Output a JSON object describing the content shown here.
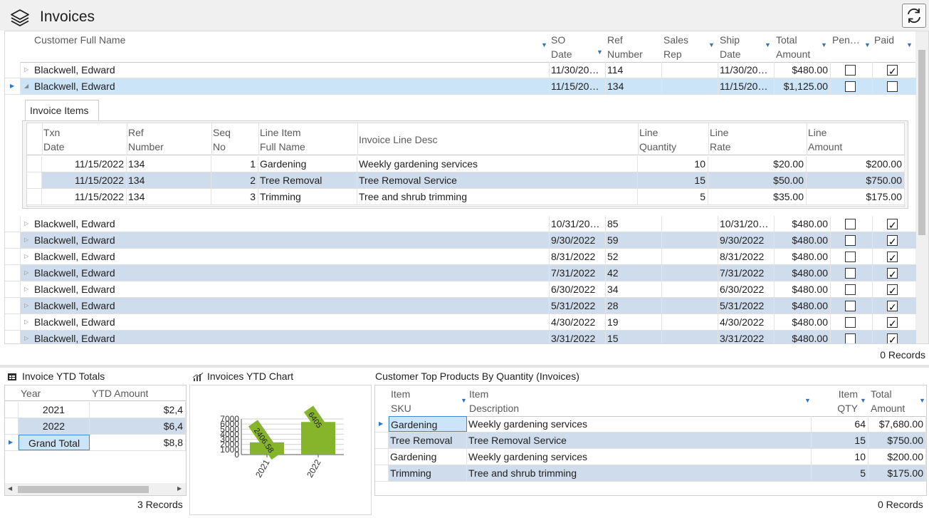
{
  "app": {
    "title": "Invoices"
  },
  "icons": {
    "app": "layers-icon",
    "refresh": "refresh-icon",
    "filter": "filter-icon",
    "totals": "table-icon",
    "chart": "chart-icon"
  },
  "colors": {
    "alt_row": "#cfdcec",
    "selected_row": "#cce4f7",
    "bar_fill": "#86b52b"
  },
  "invoices": {
    "columns": [
      "Customer Full Name",
      "SO Date",
      "Ref Number",
      "Sales Rep",
      "Ship Date",
      "Total Amount",
      "Pen…",
      "Paid"
    ],
    "header_lines": {
      "so_date": [
        "SO",
        "Date"
      ],
      "ref": [
        "Ref",
        "Number"
      ],
      "sales": [
        "Sales",
        "Rep"
      ],
      "ship": [
        "Ship",
        "Date"
      ],
      "total": [
        "Total",
        "Amount"
      ]
    },
    "rows": [
      {
        "customer": "Blackwell, Edward",
        "so_date": "11/30/20…",
        "ref": "114",
        "sales_rep": "",
        "ship_date": "11/30/20…",
        "total": "$480.00",
        "pending": false,
        "paid": true
      },
      {
        "customer": "Blackwell, Edward",
        "so_date": "11/15/20…",
        "ref": "134",
        "sales_rep": "",
        "ship_date": "11/15/20…",
        "total": "$1,125.00",
        "pending": false,
        "paid": false
      },
      {
        "customer": "Blackwell, Edward",
        "so_date": "10/31/20…",
        "ref": "85",
        "sales_rep": "",
        "ship_date": "10/31/20…",
        "total": "$480.00",
        "pending": false,
        "paid": true
      },
      {
        "customer": "Blackwell, Edward",
        "so_date": "9/30/2022",
        "ref": "59",
        "sales_rep": "",
        "ship_date": "9/30/2022",
        "total": "$480.00",
        "pending": false,
        "paid": true
      },
      {
        "customer": "Blackwell, Edward",
        "so_date": "8/31/2022",
        "ref": "52",
        "sales_rep": "",
        "ship_date": "8/31/2022",
        "total": "$480.00",
        "pending": false,
        "paid": true
      },
      {
        "customer": "Blackwell, Edward",
        "so_date": "7/31/2022",
        "ref": "42",
        "sales_rep": "",
        "ship_date": "7/31/2022",
        "total": "$480.00",
        "pending": false,
        "paid": true
      },
      {
        "customer": "Blackwell, Edward",
        "so_date": "6/30/2022",
        "ref": "34",
        "sales_rep": "",
        "ship_date": "6/30/2022",
        "total": "$480.00",
        "pending": false,
        "paid": true
      },
      {
        "customer": "Blackwell, Edward",
        "so_date": "5/31/2022",
        "ref": "28",
        "sales_rep": "",
        "ship_date": "5/31/2022",
        "total": "$480.00",
        "pending": false,
        "paid": true
      },
      {
        "customer": "Blackwell, Edward",
        "so_date": "4/30/2022",
        "ref": "19",
        "sales_rep": "",
        "ship_date": "4/30/2022",
        "total": "$480.00",
        "pending": false,
        "paid": true
      },
      {
        "customer": "Blackwell, Edward",
        "so_date": "3/31/2022",
        "ref": "15",
        "sales_rep": "",
        "ship_date": "3/31/2022",
        "total": "$480.00",
        "pending": false,
        "paid": true
      }
    ],
    "records_label": "0 Records"
  },
  "detail": {
    "tab_label": "Invoice Items",
    "header_lines": {
      "txn": [
        "Txn",
        "Date"
      ],
      "ref": [
        "Ref",
        "Number"
      ],
      "seq": [
        "Seq",
        "No"
      ],
      "item": [
        "Line Item",
        "Full Name"
      ],
      "desc": [
        "Invoice Line Desc"
      ],
      "qty": [
        "Line",
        "Quantity"
      ],
      "rate": [
        "Line",
        "Rate"
      ],
      "amount": [
        "Line",
        "Amount"
      ]
    },
    "rows": [
      {
        "txn_date": "11/15/2022",
        "ref": "134",
        "seq": "1",
        "item": "Gardening",
        "desc": "Weekly gardening services",
        "qty": "10",
        "rate": "$20.00",
        "amount": "$200.00"
      },
      {
        "txn_date": "11/15/2022",
        "ref": "134",
        "seq": "2",
        "item": "Tree Removal",
        "desc": "Tree Removal Service",
        "qty": "15",
        "rate": "$50.00",
        "amount": "$750.00"
      },
      {
        "txn_date": "11/15/2022",
        "ref": "134",
        "seq": "3",
        "item": "Trimming",
        "desc": "Tree and shrub trimming",
        "qty": "5",
        "rate": "$35.00",
        "amount": "$175.00"
      }
    ]
  },
  "ytd_totals": {
    "title": "Invoice YTD Totals",
    "col_year": "Year",
    "col_amount": "YTD Amount",
    "rows": [
      {
        "year": "2021",
        "amount": "$2,4"
      },
      {
        "year": "2022",
        "amount": "$6,4"
      },
      {
        "year": "Grand Total",
        "amount": "$8,8"
      }
    ],
    "records_label": "3 Records"
  },
  "chart": {
    "title": "Invoices YTD Chart"
  },
  "chart_data": {
    "type": "bar",
    "categories": [
      "2021",
      "2022"
    ],
    "values": [
      2406.58,
      6405
    ],
    "data_labels": [
      "2406.58",
      "6405"
    ],
    "ylim": [
      0,
      7000
    ],
    "yticks": [
      "7000",
      "6000",
      "5000",
      "4000",
      "3000",
      "2000",
      "1000",
      "0"
    ],
    "ytick_values": [
      7000,
      6000,
      5000,
      4000,
      3000,
      2000,
      1000,
      0
    ],
    "grid": true,
    "title": "",
    "xlabel": "",
    "ylabel": ""
  },
  "top_products": {
    "title": "Customer Top Products By Quantity (Invoices)",
    "header_lines": {
      "sku": [
        "Item",
        "SKU"
      ],
      "desc": [
        "Item",
        "Description"
      ],
      "qty": [
        "Item",
        "QTY"
      ],
      "amount": [
        "Total",
        "Amount"
      ]
    },
    "rows": [
      {
        "sku": "Gardening",
        "desc": "Weekly gardening services",
        "qty": "64",
        "amount": "$7,680.00"
      },
      {
        "sku": "Tree Removal",
        "desc": "Tree Removal Service",
        "qty": "15",
        "amount": "$750.00"
      },
      {
        "sku": "Gardening",
        "desc": "Weekly gardening services",
        "qty": "10",
        "amount": "$200.00"
      },
      {
        "sku": "Trimming",
        "desc": "Tree and shrub trimming",
        "qty": "5",
        "amount": "$175.00"
      }
    ],
    "records_label": "0 Records"
  }
}
